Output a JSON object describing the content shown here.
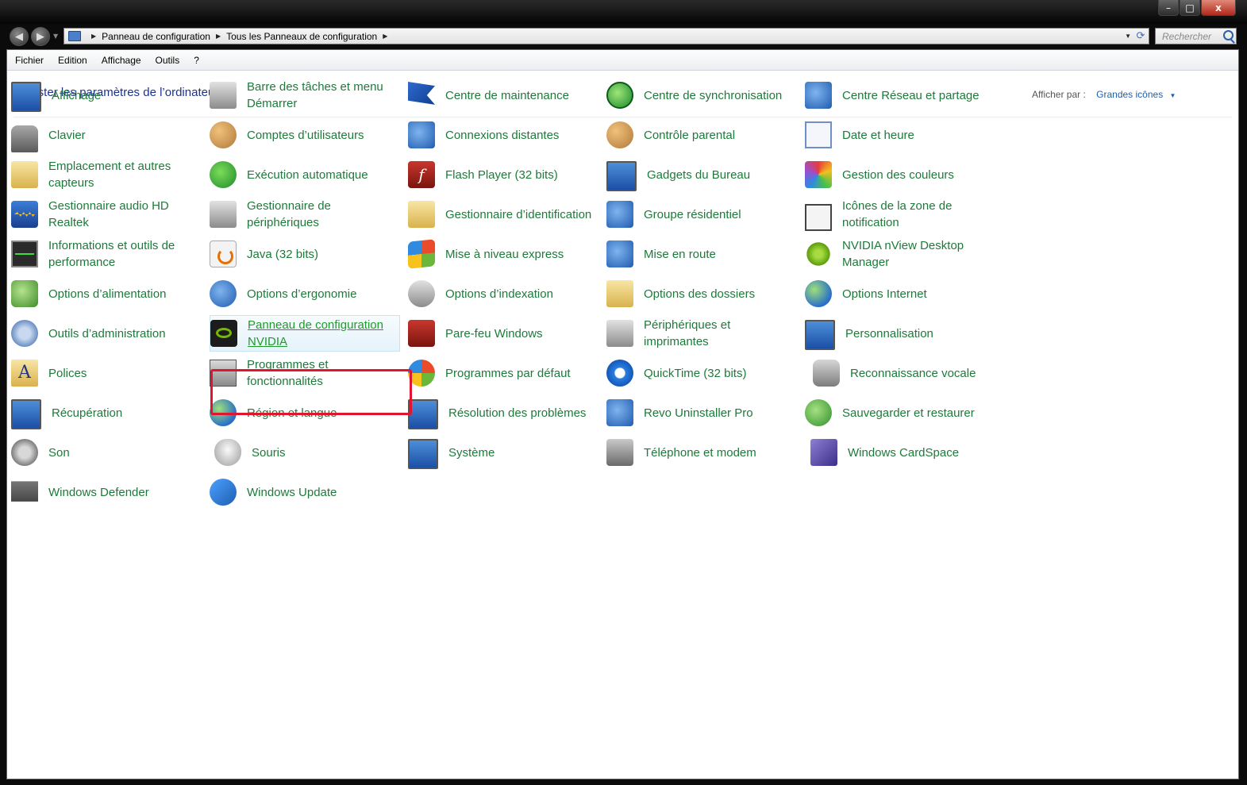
{
  "window": {
    "controls": {
      "minimize": "–",
      "maximize": "□",
      "close": "x"
    }
  },
  "addressbar": {
    "breadcrumbs": [
      "Panneau de configuration",
      "Tous les Panneaux de configuration"
    ],
    "search_placeholder": "Rechercher"
  },
  "menu": [
    "Fichier",
    "Edition",
    "Affichage",
    "Outils",
    "?"
  ],
  "header": {
    "title": "Ajuster les paramètres de l’ordinateur",
    "view_by_label": "Afficher par :",
    "view_by_value": "Grandes icônes"
  },
  "items": [
    {
      "label": "Affichage",
      "icon": "display-icon"
    },
    {
      "label": "Barre des tâches et menu Démarrer",
      "icon": "taskbar-icon"
    },
    {
      "label": "Centre de maintenance",
      "icon": "flag-icon"
    },
    {
      "label": "Centre de synchronisation",
      "icon": "sync-icon"
    },
    {
      "label": "Centre Réseau et partage",
      "icon": "network-icon"
    },
    {
      "label": "Clavier",
      "icon": "keyboard-icon"
    },
    {
      "label": "Comptes d’utilisateurs",
      "icon": "users-icon"
    },
    {
      "label": "Connexions distantes",
      "icon": "remote-icon"
    },
    {
      "label": "Contrôle parental",
      "icon": "parental-icon"
    },
    {
      "label": "Date et heure",
      "icon": "calendar-icon"
    },
    {
      "label": "Emplacement et autres capteurs",
      "icon": "sensor-icon"
    },
    {
      "label": "Exécution automatique",
      "icon": "autoplay-icon"
    },
    {
      "label": "Flash Player (32 bits)",
      "icon": "flash-icon"
    },
    {
      "label": "Gadgets du Bureau",
      "icon": "gadgets-icon"
    },
    {
      "label": "Gestion des couleurs",
      "icon": "color-icon"
    },
    {
      "label": "Gestionnaire audio HD Realtek",
      "icon": "audio-icon"
    },
    {
      "label": "Gestionnaire de périphériques",
      "icon": "device-manager-icon"
    },
    {
      "label": "Gestionnaire d’identification",
      "icon": "credential-icon"
    },
    {
      "label": "Groupe résidentiel",
      "icon": "homegroup-icon"
    },
    {
      "label": "Icônes de la zone de notification",
      "icon": "tray-icon"
    },
    {
      "label": "Informations et outils de performance",
      "icon": "performance-icon"
    },
    {
      "label": "Java (32 bits)",
      "icon": "java-icon"
    },
    {
      "label": "Mise à niveau express",
      "icon": "windows-anytime-icon"
    },
    {
      "label": "Mise en route",
      "icon": "getting-started-icon"
    },
    {
      "label": "NVIDIA nView Desktop Manager",
      "icon": "nview-icon"
    },
    {
      "label": "Options d’alimentation",
      "icon": "power-icon"
    },
    {
      "label": "Options d’ergonomie",
      "icon": "ease-of-access-icon"
    },
    {
      "label": "Options d’indexation",
      "icon": "indexing-icon"
    },
    {
      "label": "Options des dossiers",
      "icon": "folder-icon"
    },
    {
      "label": "Options Internet",
      "icon": "internet-icon"
    },
    {
      "label": "Outils d’administration",
      "icon": "admin-icon"
    },
    {
      "label": "Panneau de configuration NVIDIA",
      "icon": "nvidia-icon"
    },
    {
      "label": "Pare-feu Windows",
      "icon": "firewall-icon"
    },
    {
      "label": "Périphériques et imprimantes",
      "icon": "printer-icon"
    },
    {
      "label": "Personnalisation",
      "icon": "personalization-icon"
    },
    {
      "label": "Polices",
      "icon": "fonts-icon"
    },
    {
      "label": "Programmes et fonctionnalités",
      "icon": "programs-icon"
    },
    {
      "label": "Programmes par défaut",
      "icon": "default-programs-icon"
    },
    {
      "label": "QuickTime (32 bits)",
      "icon": "quicktime-icon"
    },
    {
      "label": "Reconnaissance vocale",
      "icon": "microphone-icon"
    },
    {
      "label": "Récupération",
      "icon": "recovery-icon"
    },
    {
      "label": "Région et langue",
      "icon": "region-icon"
    },
    {
      "label": "Résolution des problèmes",
      "icon": "troubleshoot-icon"
    },
    {
      "label": "Revo Uninstaller Pro",
      "icon": "revo-icon"
    },
    {
      "label": "Sauvegarder et restaurer",
      "icon": "backup-icon"
    },
    {
      "label": "Son",
      "icon": "speaker-icon"
    },
    {
      "label": "Souris",
      "icon": "mouse-icon"
    },
    {
      "label": "Système",
      "icon": "system-icon"
    },
    {
      "label": "Téléphone et modem",
      "icon": "phone-icon"
    },
    {
      "label": "Windows CardSpace",
      "icon": "cardspace-icon"
    },
    {
      "label": "Windows Defender",
      "icon": "defender-icon"
    },
    {
      "label": "Windows Update",
      "icon": "windows-update-icon"
    }
  ],
  "selected_item": "Panneau de configuration NVIDIA",
  "colors": {
    "link": "#1e7a3a",
    "title": "#1e3287",
    "highlight_box": "#e01530"
  }
}
